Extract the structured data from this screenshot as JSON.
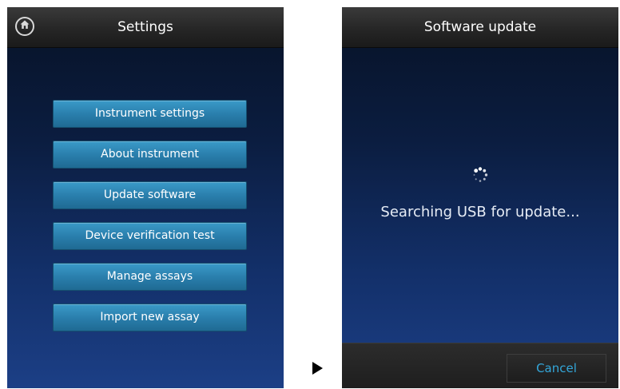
{
  "settings_screen": {
    "title": "Settings",
    "menu": [
      {
        "label": "Instrument settings"
      },
      {
        "label": "About instrument"
      },
      {
        "label": "Update software"
      },
      {
        "label": "Device verification test"
      },
      {
        "label": "Manage assays"
      },
      {
        "label": "Import new assay"
      }
    ],
    "home_icon": "home-icon"
  },
  "update_screen": {
    "title": "Software update",
    "status": "Searching USB for update...",
    "spinner_icon": "loading-spinner-icon",
    "cancel_label": "Cancel"
  },
  "transition_icon": "right-arrow-icon",
  "colors": {
    "button_blue": "#2a7fad",
    "cancel_text": "#33a6d9",
    "title_bar": "#262626"
  }
}
